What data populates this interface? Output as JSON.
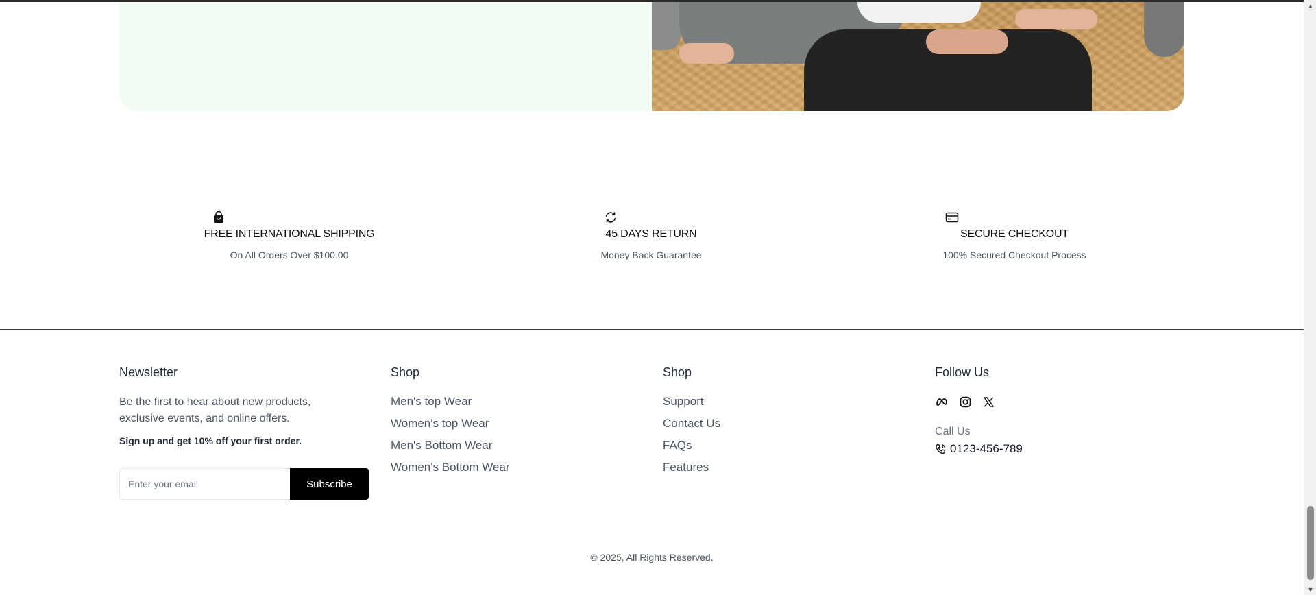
{
  "features": [
    {
      "icon": "shopping-bag-icon",
      "title": "FREE INTERNATIONAL SHIPPING",
      "subtitle": "On All Orders Over $100.00"
    },
    {
      "icon": "refresh-icon",
      "title": "45 DAYS RETURN",
      "subtitle": "Money Back Guarantee"
    },
    {
      "icon": "credit-card-icon",
      "title": "SECURE CHECKOUT",
      "subtitle": "100% Secured Checkout Process"
    }
  ],
  "newsletter": {
    "heading": "Newsletter",
    "description": "Be the first to hear about new products, exclusive events, and online offers.",
    "offer": "Sign up and get 10% off your first order.",
    "email_placeholder": "Enter your email",
    "subscribe_label": "Subscribe"
  },
  "shop_col": {
    "heading": "Shop",
    "links": [
      "Men's top Wear",
      "Women's top Wear",
      "Men's Bottom Wear",
      "Women's Bottom Wear"
    ]
  },
  "support_col": {
    "heading": "Shop",
    "links": [
      "Support",
      "Contact Us",
      "FAQs",
      "Features"
    ]
  },
  "follow": {
    "heading": "Follow Us",
    "social_icons": [
      "meta-icon",
      "instagram-icon",
      "x-icon"
    ],
    "call_label": "Call Us",
    "phone": "0123-456-789"
  },
  "copyright": "© 2025, All Rights Reserved.",
  "colors": {
    "hero_left_bg": "#f0fcf4",
    "button_bg": "#000000",
    "text_muted": "#4b5563"
  }
}
